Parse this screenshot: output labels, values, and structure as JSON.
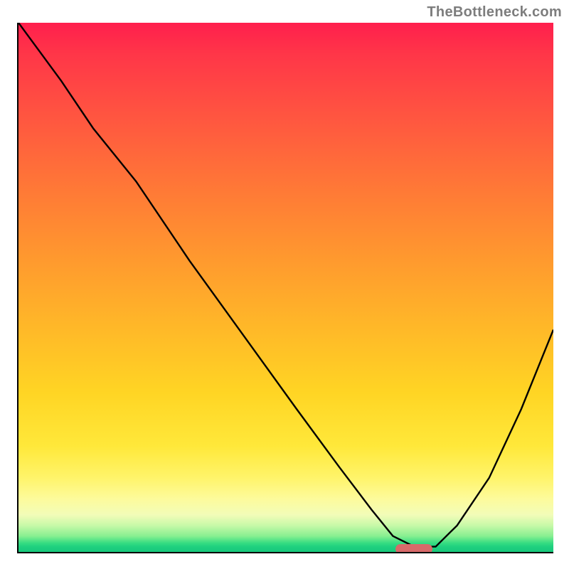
{
  "attribution": "TheBottleneck.com",
  "colors": {
    "grad_top": "#ff1f4d",
    "grad_bottom": "#18c97c",
    "axis": "#000000",
    "curve": "#000000",
    "marker": "#d86a6a",
    "attribution_text": "#7d7d7d"
  },
  "chart_data": {
    "type": "line",
    "title": "",
    "xlabel": "",
    "ylabel": "",
    "xlim": [
      0,
      100
    ],
    "ylim": [
      0,
      100
    ],
    "grid": false,
    "legend": false,
    "series": [
      {
        "name": "bottleneck-curve",
        "x": [
          0,
          8,
          14,
          22,
          32,
          42,
          52,
          60,
          66,
          70,
          74,
          78,
          82,
          88,
          94,
          100
        ],
        "y": [
          100,
          89,
          80,
          70,
          55,
          41,
          27,
          16,
          8,
          3,
          1,
          1,
          5,
          14,
          27,
          42
        ]
      }
    ],
    "annotations": [
      {
        "name": "minimum-marker",
        "x": 74,
        "y": 0.6
      }
    ]
  }
}
